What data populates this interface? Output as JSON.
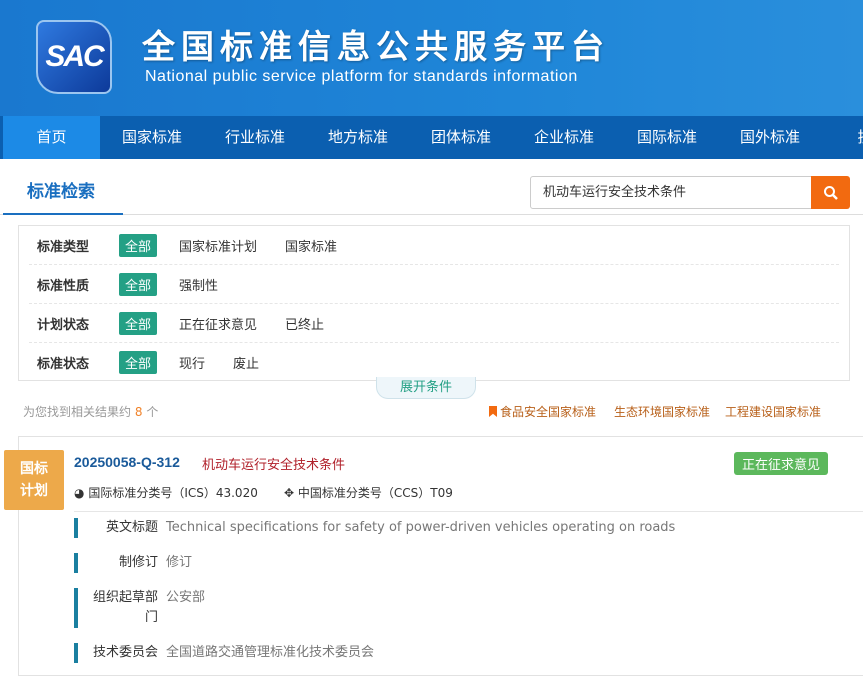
{
  "header": {
    "logo": "SAC",
    "title": "全国标准信息公共服务平台",
    "subtitle": "National public service platform  for standards information"
  },
  "nav": [
    "首页",
    "国家标准",
    "行业标准",
    "地方标准",
    "团体标准",
    "企业标准",
    "国际标准",
    "国外标准",
    "技术"
  ],
  "search": {
    "tab": "标准检索",
    "value": "机动车运行安全技术条件",
    "icon": "search-icon"
  },
  "filters": [
    {
      "label": "标准类型",
      "all": "全部",
      "options": [
        "国家标准计划",
        "国家标准"
      ]
    },
    {
      "label": "标准性质",
      "all": "全部",
      "options": [
        "强制性"
      ]
    },
    {
      "label": "计划状态",
      "all": "全部",
      "options": [
        "正在征求意见",
        "已终止"
      ]
    },
    {
      "label": "标准状态",
      "all": "全部",
      "options": [
        "现行",
        "废止"
      ]
    }
  ],
  "expand": "展开条件",
  "results": {
    "prefix": "为您找到相关结果约",
    "count": "8",
    "suffix": "个"
  },
  "quick_links": [
    "食品安全国家标准",
    "生态环境国家标准",
    "工程建设国家标准"
  ],
  "item": {
    "badge": "国标计划",
    "code": "20250058-Q-312",
    "name": "机动车运行安全技术条件",
    "status": "正在征求意见",
    "ics": "国际标准分类号（ICS）43.020",
    "ccs": "中国标准分类号（CCS）T09",
    "fields": [
      {
        "k": "英文标题",
        "v": "Technical specifications for safety of power-driven vehicles operating on roads"
      },
      {
        "k": "制修订",
        "v": "修订"
      },
      {
        "k": "组织起草部门",
        "v": "公安部"
      },
      {
        "k": "技术委员会",
        "v": "全国道路交通管理标准化技术委员会"
      }
    ]
  },
  "colors": {
    "nav": "#0b5fb0",
    "accent": "#f26a10",
    "green": "#24a085",
    "status": "#5cb85c",
    "badge": "#eda94a"
  }
}
